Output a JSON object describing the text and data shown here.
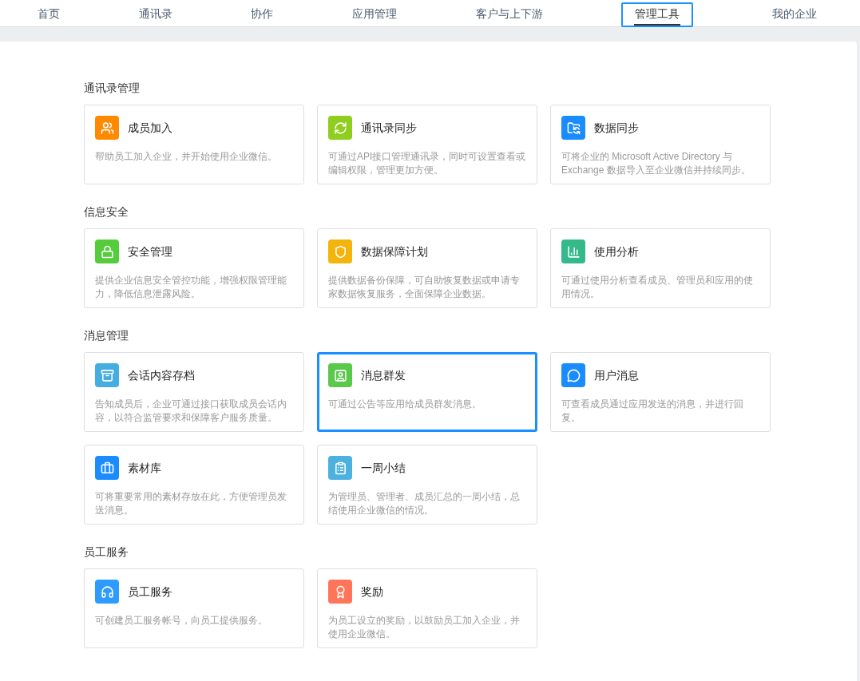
{
  "nav": {
    "tabs": [
      {
        "label": "首页",
        "selected": false
      },
      {
        "label": "通讯录",
        "selected": false
      },
      {
        "label": "协作",
        "selected": false
      },
      {
        "label": "应用管理",
        "selected": false
      },
      {
        "label": "客户与上下游",
        "selected": false
      },
      {
        "label": "管理工具",
        "selected": true
      },
      {
        "label": "我的企业",
        "selected": false
      }
    ]
  },
  "sections": [
    {
      "title": "通讯录管理",
      "cards": [
        {
          "title": "成员加入",
          "description": "帮助员工加入企业，并开始使用企业微信。",
          "color": "#ff8a00",
          "selected": false
        },
        {
          "title": "通讯录同步",
          "description": "可通过API接口管理通讯录，同时可设置查看或编辑权限，管理更加方便。",
          "color": "#8fce1e",
          "selected": false
        },
        {
          "title": "数据同步",
          "description": "可将企业的 Microsoft Active Directory 与 Exchange 数据导入至企业微信并持续同步。",
          "color": "#1a8cff",
          "selected": false
        }
      ]
    },
    {
      "title": "信息安全",
      "cards": [
        {
          "title": "安全管理",
          "description": "提供企业信息安全管控功能，增强权限管理能力，降低信息泄露风险。",
          "color": "#55cc3c",
          "selected": false
        },
        {
          "title": "数据保障计划",
          "description": "提供数据备份保障，可自助恢复数据或申请专家数据恢复服务，全面保障企业数据。",
          "color": "#f3b40c",
          "selected": false
        },
        {
          "title": "使用分析",
          "description": "可通过使用分析查看成员、管理员和应用的使用情况。",
          "color": "#33b98a",
          "selected": false
        }
      ]
    },
    {
      "title": "消息管理",
      "cards": [
        {
          "title": "会话内容存档",
          "description": "告知成员后，企业可通过接口获取成员会话内容，以符合监管要求和保障客户服务质量。",
          "color": "#45ade0",
          "selected": false
        },
        {
          "title": "消息群发",
          "description": "可通过公告等应用给成员群发消息。",
          "color": "#5ac84a",
          "selected": true
        },
        {
          "title": "用户消息",
          "description": "可查看成员通过应用发送的消息，并进行回复。",
          "color": "#1a8cff",
          "selected": false
        },
        {
          "title": "素材库",
          "description": "可将重要常用的素材存放在此，方便管理员发送消息。",
          "color": "#1a8cff",
          "selected": false
        },
        {
          "title": "一周小结",
          "description": "为管理员、管理者、成员汇总的一周小结，总结使用企业微信的情况。",
          "color": "#4db1e0",
          "selected": false
        }
      ]
    },
    {
      "title": "员工服务",
      "cards": [
        {
          "title": "员工服务",
          "description": "可创建员工服务帐号，向员工提供服务。",
          "color": "#2e9bff",
          "selected": false
        },
        {
          "title": "奖励",
          "description": "为员工设立的奖励，以鼓励员工加入企业，并使用企业微信。",
          "color": "#ff7559",
          "selected": false
        }
      ]
    }
  ]
}
